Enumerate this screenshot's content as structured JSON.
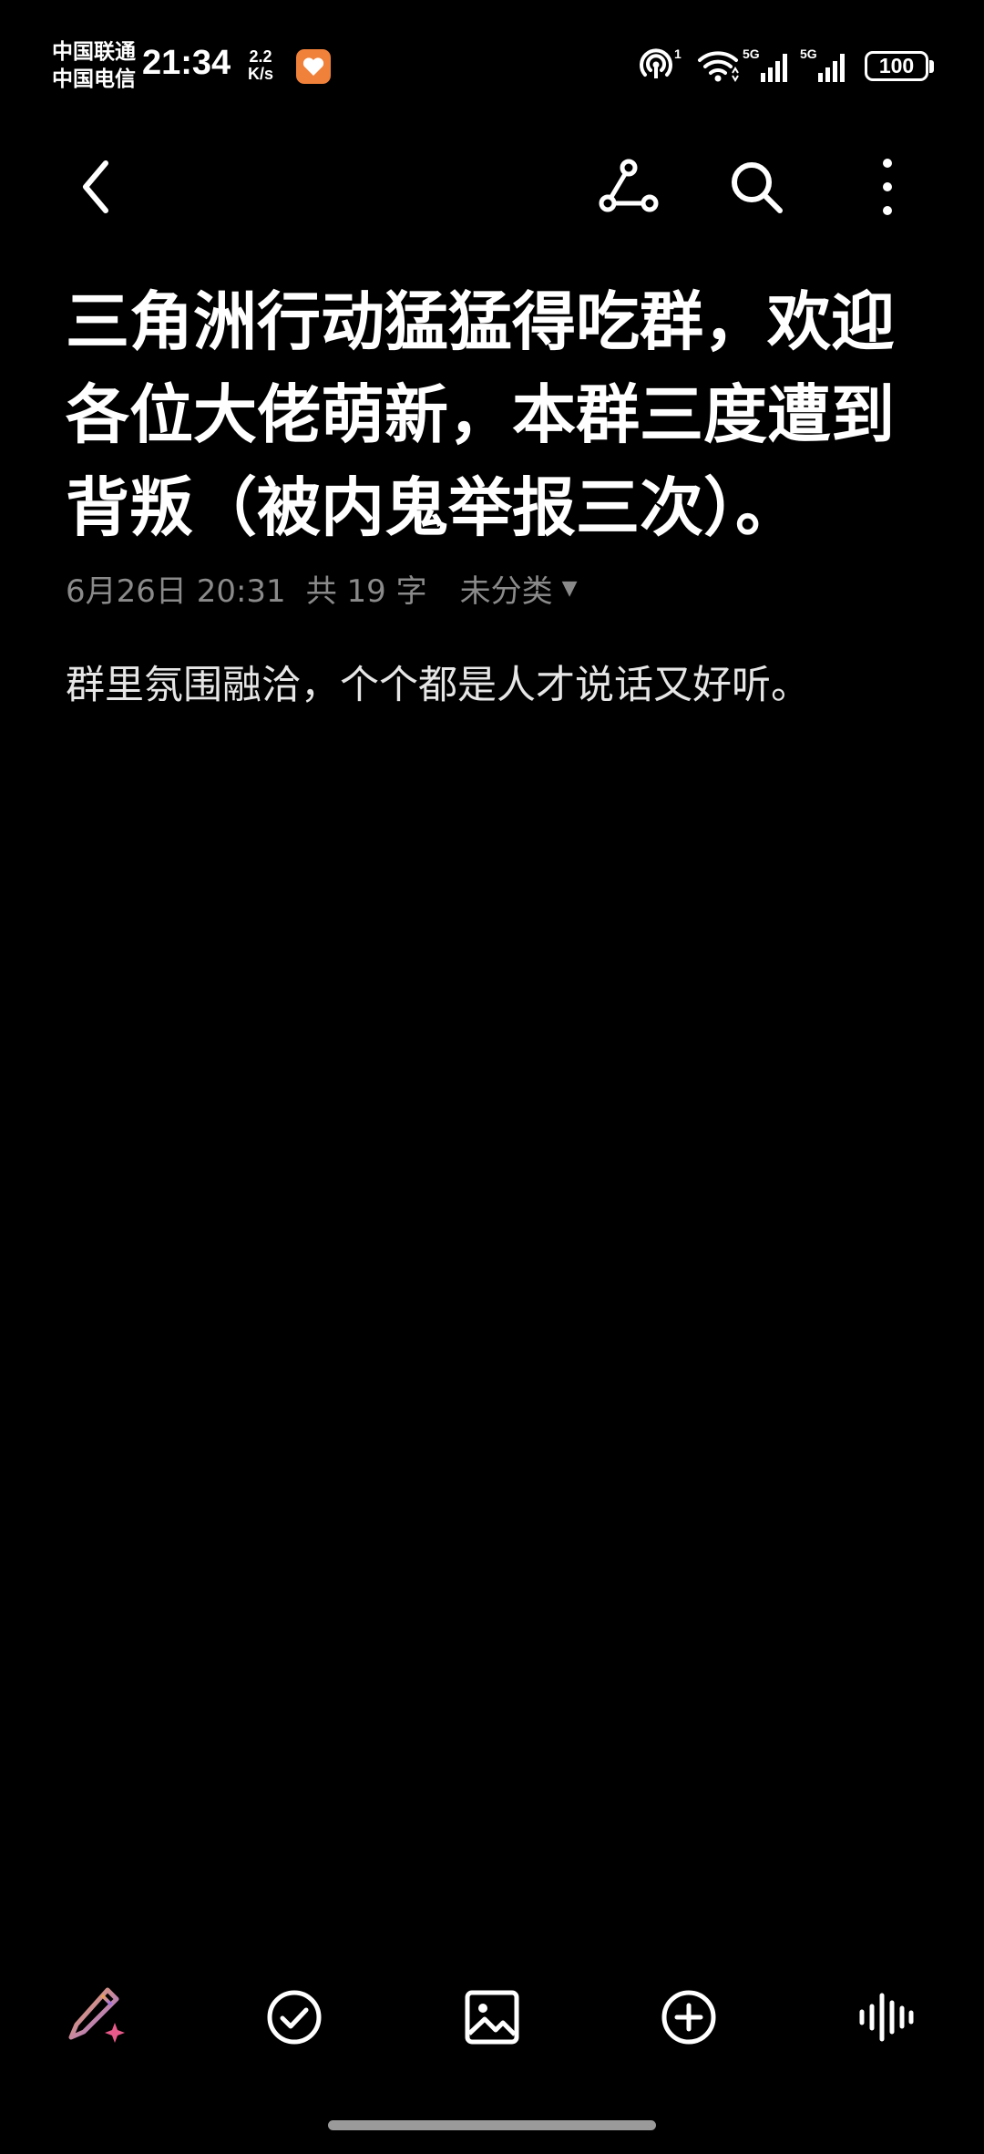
{
  "status_bar": {
    "carrier_1": "中国联通",
    "carrier_2": "中国电信",
    "time": "21:34",
    "net_speed_value": "2.2",
    "net_speed_unit": "K/s",
    "hotspot_count": "1",
    "signal_1_label": "5G",
    "signal_2_label": "5G",
    "battery": "100",
    "icons": [
      "app-notification-icon",
      "hotspot-icon",
      "wifi-icon",
      "signal-5g-icon",
      "signal-5g-icon",
      "battery-icon"
    ]
  },
  "top_bar": {
    "icons": [
      "back-arrow-icon",
      "share-graph-icon",
      "search-icon",
      "more-vertical-icon"
    ]
  },
  "note": {
    "title": "三角洲行动猛猛得吃群，欢迎各位大佬萌新，本群三度遭到背叛（被内鬼举报三次）。",
    "date": "6月26日 20:31",
    "word_count": "共 19 字",
    "category": "未分类",
    "body": "群里氛围融洽，个个都是人才说话又好听。"
  },
  "bottom_toolbar": {
    "icons": [
      "ai-pen-icon",
      "checklist-icon",
      "image-icon",
      "add-circle-icon",
      "voice-wave-icon"
    ]
  },
  "colors": {
    "background": "#000000",
    "text": "#ffffff",
    "meta_text": "#8a8a8a",
    "accent_orange": "#f0813a",
    "pen_gradient_start": "#f3a64a",
    "pen_gradient_end": "#9b6cf0"
  }
}
